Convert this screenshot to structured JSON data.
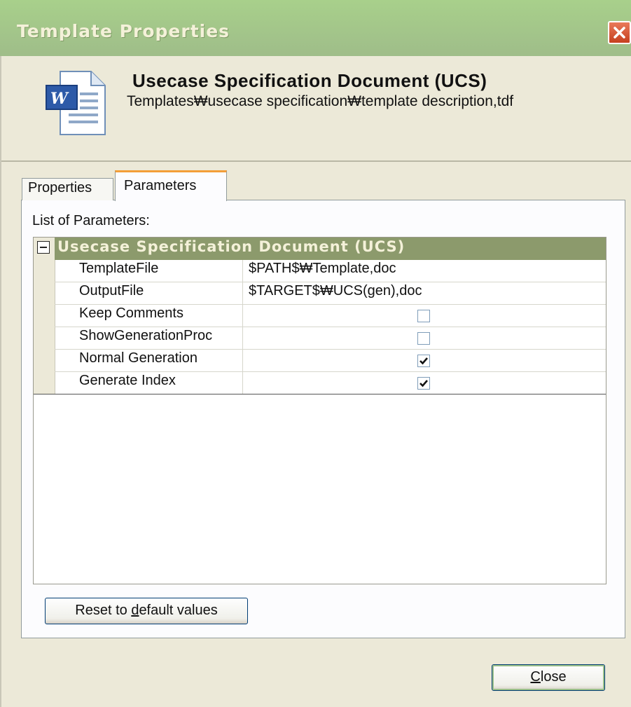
{
  "window": {
    "title": "Template Properties",
    "close_icon": "close-icon"
  },
  "header": {
    "icon": "word-document-icon",
    "doc_title": "Usecase Specification Document (UCS)",
    "doc_path": "Templates₩usecase specification₩template description,tdf"
  },
  "tabs": [
    {
      "label": "Properties",
      "active": false
    },
    {
      "label": "Parameters",
      "active": true
    }
  ],
  "parameters": {
    "list_label": "List of Parameters:",
    "group": "Usecase Specification Document (UCS)",
    "rows": [
      {
        "name": "TemplateFile",
        "value": "$PATH$₩Template,doc"
      },
      {
        "name": "OutputFile",
        "value": "$TARGET$₩UCS(gen),doc"
      },
      {
        "name": "Keep Comments",
        "checked": false
      },
      {
        "name": "ShowGenerationProc",
        "checked": false
      },
      {
        "name": "Normal Generation",
        "checked": true
      },
      {
        "name": "Generate Index",
        "checked": true
      }
    ]
  },
  "buttons": {
    "reset_pre": "Reset to ",
    "reset_underline": "d",
    "reset_post": "efault values",
    "close_underline": "C",
    "close_post": "lose"
  },
  "colors": {
    "titlebar": "#9fbd89",
    "group_row": "#8c9a6c",
    "active_tab_accent": "#f39e38",
    "dialog_bg": "#ece9d8"
  }
}
